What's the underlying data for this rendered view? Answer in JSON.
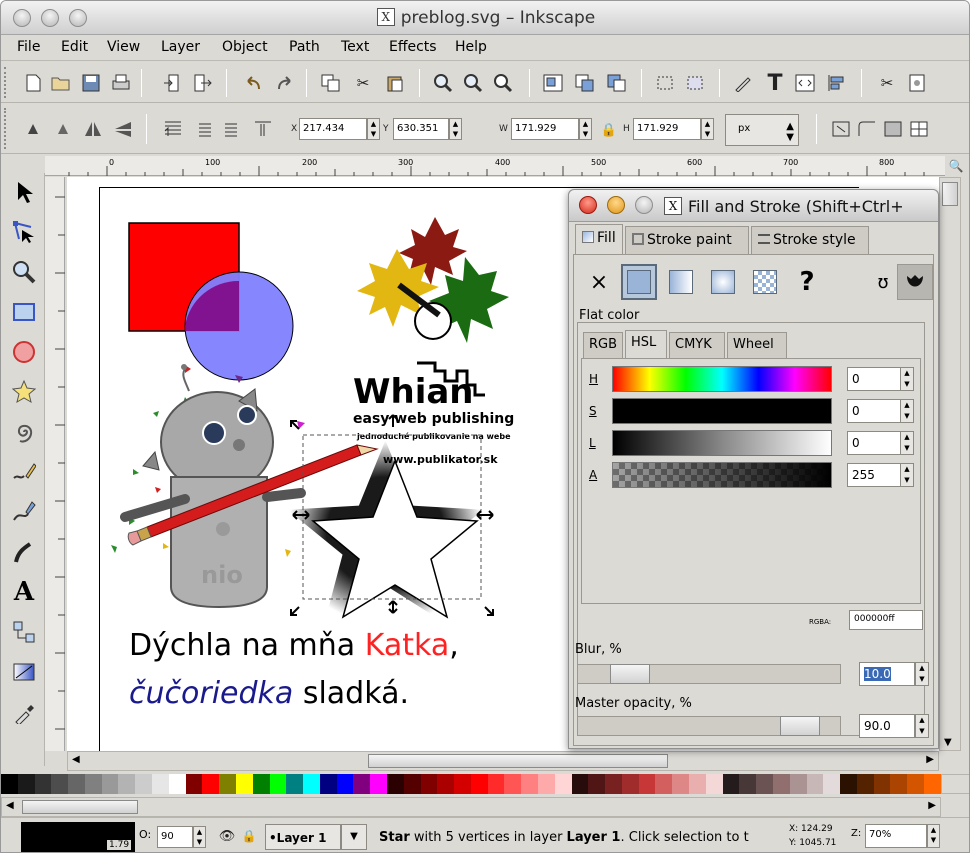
{
  "window": {
    "file_name": "preblog.svg",
    "app_name": "Inkscape",
    "title_sep": " – ",
    "x_glyph": "X"
  },
  "menu": [
    "File",
    "Edit",
    "View",
    "Layer",
    "Object",
    "Path",
    "Text",
    "Effects",
    "Help"
  ],
  "toolbar_icons": [
    "new-icon",
    "open-icon",
    "save-icon",
    "print-icon",
    "import-icon",
    "export-icon",
    "undo-icon",
    "redo-icon",
    "duplicate-icon",
    "cut-icon",
    "paste-icon",
    "zoom-selection-icon",
    "zoom-drawing-icon",
    "zoom-page-icon",
    "group-icon",
    "ungroup-icon",
    "clone-icon",
    "node-icon",
    "text-icon",
    "xml-editor-icon",
    "align-icon",
    "preferences-icon",
    "document-properties-icon"
  ],
  "select_toolbar": {
    "x_label": "X",
    "x_value": "217.434",
    "y_label": "Y",
    "y_value": "630.351",
    "w_label": "W",
    "w_value": "171.929",
    "h_label": "H",
    "h_value": "171.929",
    "unit": "px"
  },
  "ruler": {
    "top_labels": [
      "0",
      "100",
      "200",
      "300",
      "400",
      "500",
      "600",
      "700",
      "800"
    ]
  },
  "tools": [
    "selector-icon",
    "node-icon",
    "zoom-icon",
    "rect-icon",
    "ellipse-icon",
    "star-icon",
    "spiral-icon",
    "pencil-icon",
    "pen-icon",
    "calligraphy-icon",
    "text-icon",
    "connector-icon",
    "gradient-icon",
    "dropper-icon"
  ],
  "canvas": {
    "whian_title": "Whian",
    "whian_sub": "easy web publishing",
    "whian_sub2": "jednoduché publikovanie na webe",
    "whian_url": "www.publikator.sk",
    "robot_label": "nio",
    "line1_a": "Dýchla na mňa ",
    "line1_b": "Katka",
    "line1_c": ",",
    "line2_a": "čučoriedka",
    "line2_b": " sladká.",
    "colors": {
      "red": "#ff0000",
      "blue_text": "#1a1a8c",
      "circle": "#8080ff",
      "leaf_green": "#1a6b12",
      "leaf_yellow": "#e2b711",
      "leaf_red": "#8b1a12"
    }
  },
  "dialog": {
    "title": "Fill and Stroke (Shift+Ctrl+",
    "x_glyph": "X",
    "tabs": [
      "Fill",
      "Stroke paint",
      "Stroke style"
    ],
    "paint_types": [
      "×",
      "?"
    ],
    "flat_color": "Flat color",
    "subtabs": [
      "RGB",
      "HSL",
      "CMYK",
      "Wheel"
    ],
    "sliders": [
      {
        "label": "H",
        "value": "0"
      },
      {
        "label": "S",
        "value": "0"
      },
      {
        "label": "L",
        "value": "0"
      },
      {
        "label": "A",
        "value": "255"
      }
    ],
    "rgba_label": "RGBA:",
    "rgba_value": "000000ff",
    "blur_label": "Blur, %",
    "blur_value": "10.0",
    "blur_level": 0.1,
    "opacity_label": "Master opacity, %",
    "opacity_value": "90.0",
    "opacity_level": 0.9
  },
  "palette": [
    "#000000",
    "#1a1a1a",
    "#333333",
    "#4d4d4d",
    "#666666",
    "#808080",
    "#999999",
    "#b3b3b3",
    "#cccccc",
    "#e6e6e6",
    "#ffffff",
    "#800000",
    "#ff0000",
    "#808000",
    "#ffff00",
    "#008000",
    "#00ff00",
    "#008080",
    "#00ffff",
    "#000080",
    "#0000ff",
    "#800080",
    "#ff00ff",
    "#2b0000",
    "#550000",
    "#800000",
    "#aa0000",
    "#d40000",
    "#ff0000",
    "#ff2a2a",
    "#ff5555",
    "#ff8080",
    "#ffaaaa",
    "#ffd5d5",
    "#280b0b",
    "#501616",
    "#782121",
    "#a02c2c",
    "#c83737",
    "#d35f5f",
    "#de8787",
    "#e9afaf",
    "#f4d7d7",
    "#241c1c",
    "#483737",
    "#6c5353",
    "#916f6f",
    "#ac9393",
    "#c8b7b7",
    "#e3dbdb",
    "#2b1100",
    "#552200",
    "#803300",
    "#aa4400",
    "#d45500",
    "#ff6600"
  ],
  "status": {
    "opacity_label": "O:",
    "opacity_value": "90",
    "stroke_width": "1.79",
    "layer": "•Layer 1",
    "message_bold1": "Star",
    "message_mid": " with 5 vertices in layer ",
    "message_bold2": "Layer 1",
    "message_end": ". Click selection to t",
    "coord_x": "X: 124.29",
    "coord_y": "Y: 1045.71",
    "zoom_label": "Z:",
    "zoom_value": "70%"
  }
}
